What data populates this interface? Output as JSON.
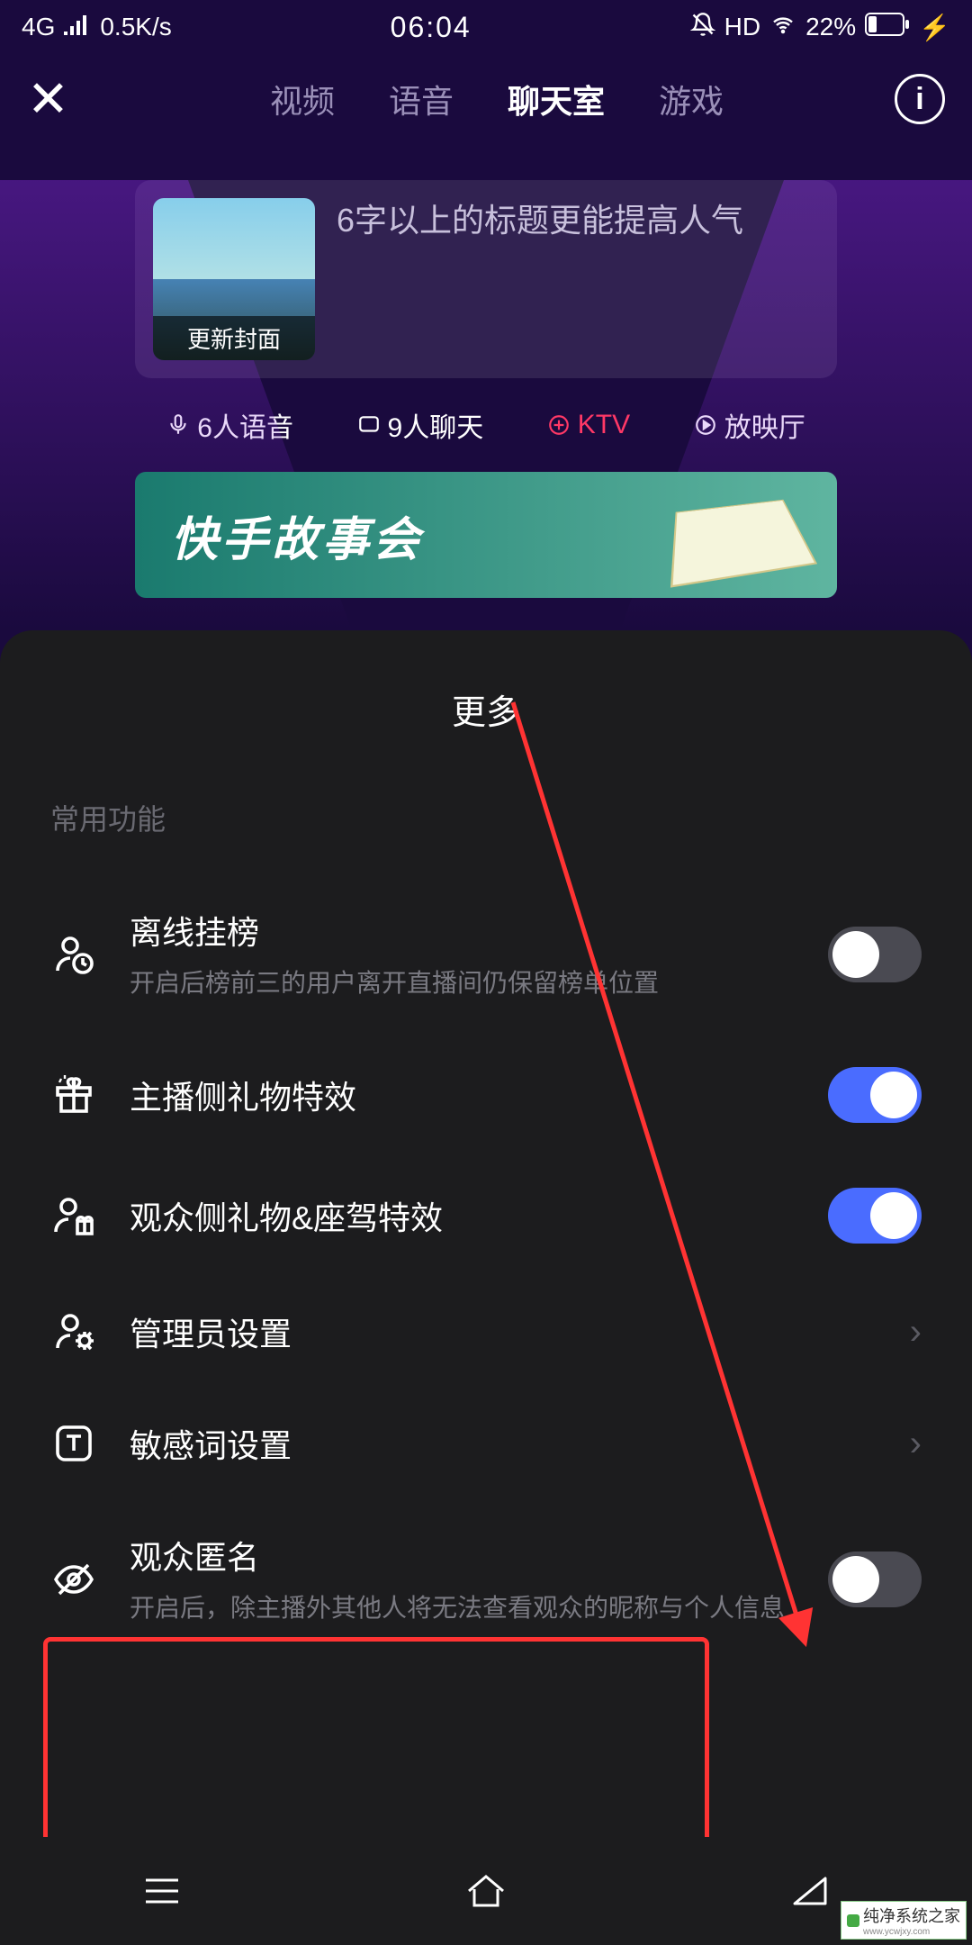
{
  "status": {
    "network": "4G",
    "speed": "0.5K/s",
    "time": "06:04",
    "hd": "HD",
    "battery": "22%"
  },
  "nav": {
    "tabs": [
      "视频",
      "语音",
      "聊天室",
      "游戏"
    ],
    "active_index": 2
  },
  "cover": {
    "update_label": "更新封面",
    "hint": "6字以上的标题更能提高人气"
  },
  "modes": {
    "voice": "6人语音",
    "chat": "9人聊天",
    "ktv": "KTV",
    "cinema": "放映厅"
  },
  "banner": {
    "text": "快手故事会"
  },
  "sheet": {
    "title": "更多",
    "section_label": "常用功能",
    "items": [
      {
        "icon": "person-clock-icon",
        "title": "离线挂榜",
        "desc": "开启后榜前三的用户离开直播间仍保留榜单位置",
        "control": "toggle",
        "value": false
      },
      {
        "icon": "gift-icon",
        "title": "主播侧礼物特效",
        "control": "toggle",
        "value": true
      },
      {
        "icon": "person-gift-icon",
        "title": "观众侧礼物&座驾特效",
        "control": "toggle",
        "value": true
      },
      {
        "icon": "person-gear-icon",
        "title": "管理员设置",
        "control": "chevron"
      },
      {
        "icon": "text-box-icon",
        "title": "敏感词设置",
        "control": "chevron"
      },
      {
        "icon": "eye-off-icon",
        "title": "观众匿名",
        "desc": "开启后，除主播外其他人将无法查看观众的昵称与个人信息",
        "control": "toggle",
        "value": false
      }
    ]
  },
  "watermark": {
    "name": "纯净系统之家",
    "url": "www.ycwjxy.com"
  }
}
